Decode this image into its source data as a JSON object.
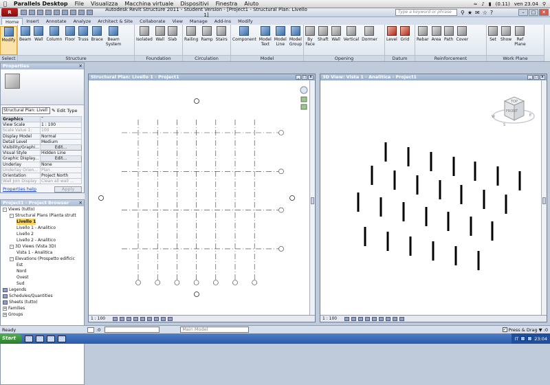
{
  "mac_menu": {
    "app": "Parallels Desktop",
    "items": [
      "File",
      "Visualizza",
      "Macchina virtuale",
      "Dispositivi",
      "Finestra",
      "Aiuto"
    ],
    "battery": "(0.11)",
    "clock": "ven 23.04"
  },
  "window": {
    "title": "Autodesk Revit Structure 2011 - Student Version - [Project1 - Structural Plan: Livello 1]",
    "search_placeholder": "Type a keyword or phrase",
    "logo": "R"
  },
  "ribbon_tabs": [
    "Home",
    "Insert",
    "Annotate",
    "Analyze",
    "Architect & Site",
    "Collaborate",
    "View",
    "Manage",
    "Add-Ins",
    "Modify"
  ],
  "active_tab": "Home",
  "ribbon_panels": [
    {
      "label": "Select",
      "tools": [
        {
          "label": "Modify",
          "icon": "arrow-icon"
        }
      ]
    },
    {
      "label": "Structure",
      "tools": [
        {
          "label": "Beam",
          "icon": "beam-icon"
        },
        {
          "label": "Wall",
          "icon": "wall-icon"
        },
        {
          "label": "Column",
          "icon": "column-icon"
        },
        {
          "label": "Floor",
          "icon": "floor-icon"
        },
        {
          "label": "Truss",
          "icon": "truss-icon"
        },
        {
          "label": "Brace",
          "icon": "brace-icon"
        },
        {
          "label": "Beam\nSystem",
          "icon": "beam-system-icon"
        }
      ]
    },
    {
      "label": "Foundation",
      "tools": [
        {
          "label": "Isolated",
          "icon": "isolated-foundation-icon"
        },
        {
          "label": "Wall",
          "icon": "wall-foundation-icon"
        },
        {
          "label": "Slab",
          "icon": "slab-icon"
        }
      ]
    },
    {
      "label": "Circulation",
      "tools": [
        {
          "label": "Railing",
          "icon": "railing-icon"
        },
        {
          "label": "Ramp",
          "icon": "ramp-icon"
        },
        {
          "label": "Stairs",
          "icon": "stairs-icon"
        }
      ]
    },
    {
      "label": "Model",
      "tools": [
        {
          "label": "Component",
          "icon": "component-icon"
        },
        {
          "label": "Model\nText",
          "icon": "model-text-icon"
        },
        {
          "label": "Model\nLine",
          "icon": "model-line-icon"
        },
        {
          "label": "Model\nGroup",
          "icon": "model-group-icon"
        }
      ]
    },
    {
      "label": "Opening",
      "tools": [
        {
          "label": "By\nFace",
          "icon": "by-face-icon"
        },
        {
          "label": "Shaft",
          "icon": "shaft-icon"
        },
        {
          "label": "Wall",
          "icon": "wall-opening-icon"
        },
        {
          "label": "Vertical",
          "icon": "vertical-opening-icon"
        },
        {
          "label": "Dormer",
          "icon": "dormer-icon"
        }
      ]
    },
    {
      "label": "Datum",
      "tools": [
        {
          "label": "Level",
          "icon": "level-icon"
        },
        {
          "label": "Grid",
          "icon": "grid-icon"
        }
      ]
    },
    {
      "label": "Reinforcement",
      "tools": [
        {
          "label": "Rebar",
          "icon": "rebar-icon"
        },
        {
          "label": "Area",
          "icon": "area-icon"
        },
        {
          "label": "Path",
          "icon": "path-icon"
        },
        {
          "label": "Cover",
          "icon": "cover-icon"
        }
      ]
    },
    {
      "label": "Work Plane",
      "tools": [
        {
          "label": "Set",
          "icon": "set-icon"
        },
        {
          "label": "Show",
          "icon": "show-icon"
        },
        {
          "label": "Ref\nPlane",
          "icon": "ref-plane-icon"
        }
      ]
    }
  ],
  "properties": {
    "title": "Properties",
    "type_selector": "Structural Plan: Livell",
    "edit_type": "Edit Type",
    "group": "Graphics",
    "rows": [
      {
        "k": "View Scale",
        "v": "1 : 100",
        "dim": false
      },
      {
        "k": "Scale Value 1:",
        "v": "100",
        "dim": true
      },
      {
        "k": "Display Model",
        "v": "Normal",
        "dim": false
      },
      {
        "k": "Detail Level",
        "v": "Medium",
        "dim": false
      },
      {
        "k": "Visibility/Graphi...",
        "v": "Edit...",
        "dim": false,
        "btn": true
      },
      {
        "k": "Visual Style",
        "v": "Hidden Line",
        "dim": false
      },
      {
        "k": "Graphic Display...",
        "v": "Edit...",
        "dim": false,
        "btn": true
      },
      {
        "k": "Underlay",
        "v": "None",
        "dim": false
      },
      {
        "k": "Underlay Orien...",
        "v": "Plan",
        "dim": true
      },
      {
        "k": "Orientation",
        "v": "Project North",
        "dim": false
      },
      {
        "k": "Wall Join Display",
        "v": "Clean all wall ...",
        "dim": true
      }
    ],
    "help_link": "Properties help",
    "apply": "Apply"
  },
  "browser": {
    "title": "Project1 - Project Browser",
    "items": [
      {
        "label": "Views (tutto)",
        "level": 0,
        "toggle": "-",
        "current": false
      },
      {
        "label": "Structural Plans (Pianta strutt",
        "level": 1,
        "toggle": "-",
        "current": false
      },
      {
        "label": "Livello 1",
        "level": 2,
        "toggle": "",
        "current": true
      },
      {
        "label": "Livello 1 - Analitico",
        "level": 2,
        "toggle": "",
        "current": false
      },
      {
        "label": "Livello 2",
        "level": 2,
        "toggle": "",
        "current": false
      },
      {
        "label": "Livello 2 - Analitico",
        "level": 2,
        "toggle": "",
        "current": false
      },
      {
        "label": "3D Views (Vista 3D)",
        "level": 1,
        "toggle": "-",
        "current": false
      },
      {
        "label": "Vista 1 - Analitica",
        "level": 2,
        "toggle": "",
        "current": false
      },
      {
        "label": "Elevations (Prospetto edificic",
        "level": 1,
        "toggle": "-",
        "current": false
      },
      {
        "label": "Est",
        "level": 2,
        "toggle": "",
        "current": false
      },
      {
        "label": "Nord",
        "level": 2,
        "toggle": "",
        "current": false
      },
      {
        "label": "Ovest",
        "level": 2,
        "toggle": "",
        "current": false
      },
      {
        "label": "Sud",
        "level": 2,
        "toggle": "",
        "current": false
      },
      {
        "label": "Legends",
        "level": 0,
        "toggle": "",
        "current": false
      },
      {
        "label": "Schedules/Quantities",
        "level": 0,
        "toggle": "",
        "current": false
      },
      {
        "label": "Sheets (tutto)",
        "level": 0,
        "toggle": "",
        "current": false
      },
      {
        "label": "Families",
        "level": 0,
        "toggle": "+",
        "current": false
      },
      {
        "label": "Groups",
        "level": 0,
        "toggle": "+",
        "current": false
      }
    ]
  },
  "plan_view": {
    "title": "Structural Plan: Livello 1 - Project1",
    "scale": "1 : 100",
    "vertical_grids": 7,
    "horizontal_grids": 4
  },
  "view3d": {
    "title": "3D View: Vista 1 - Analitica - Project1",
    "scale": "1 : 100",
    "viewcube_top": "TOP",
    "viewcube_front": "FRONT",
    "compass_w": "W",
    "compass_s": "S",
    "compass_e": "E"
  },
  "status": {
    "text": "Ready",
    "zero": ":0",
    "main_model": "Main Model",
    "press_drag": "Press & Drag"
  },
  "taskbar": {
    "start": "Start",
    "lang": "IT",
    "time": "23:04"
  }
}
